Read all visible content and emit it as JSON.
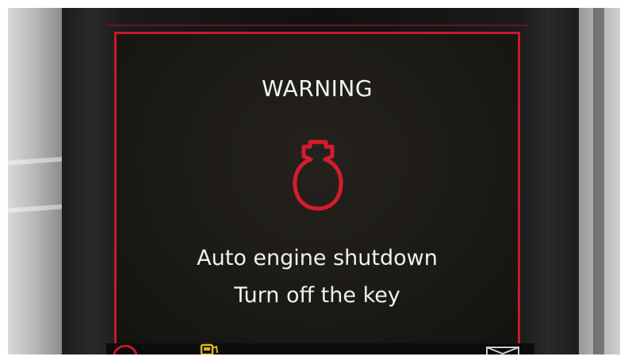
{
  "warning": {
    "title": "WARNING",
    "icon": "engine-oil-pressure-warning-icon",
    "message_line_1": "Auto engine shutdown",
    "message_line_2": "Turn off the key"
  },
  "colors": {
    "frame_red": "#c8192b",
    "screen_bg": "#1c1a16",
    "text": "#f0f0f0",
    "fuel_yellow": "#e0b21c"
  },
  "bottom_icons": [
    "tpms-icon",
    "fuel-icon",
    "message-envelope-icon"
  ]
}
